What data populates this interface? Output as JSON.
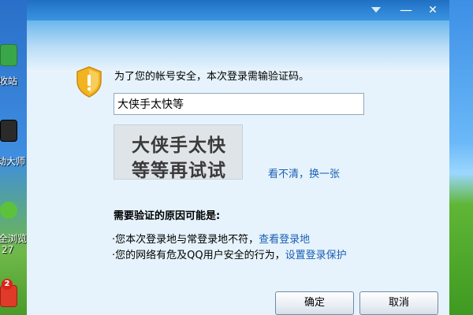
{
  "desktop": {
    "left_labels": [
      "收站",
      "劫大师",
      "全浏览",
      "27"
    ],
    "left_badge": "2"
  },
  "titlebar": {
    "dropdown_icon": "triangle-down-icon",
    "minimize_label": "—",
    "close_label": "✕"
  },
  "dialog": {
    "prompt": "为了您的帐号安全，本次登录需输验证码。",
    "captcha_input_value": "大侠手太快等",
    "captcha_image_lines": [
      "大侠手太快",
      "等等再试试"
    ],
    "refresh_link": "看不清，换一张",
    "reasons_title": "需要验证的原因可能是:",
    "reasons": [
      {
        "text": "·您本次登录地与常登录地不符，",
        "link": "查看登录地"
      },
      {
        "text": "·您的网络有危及QQ用户安全的行为，",
        "link": "设置登录保护"
      }
    ],
    "ok_label": "确定",
    "cancel_label": "取消"
  },
  "colors": {
    "titlebar": "#2f86d6",
    "link": "#1a5fb4",
    "shield_gold": "#f2b320"
  }
}
